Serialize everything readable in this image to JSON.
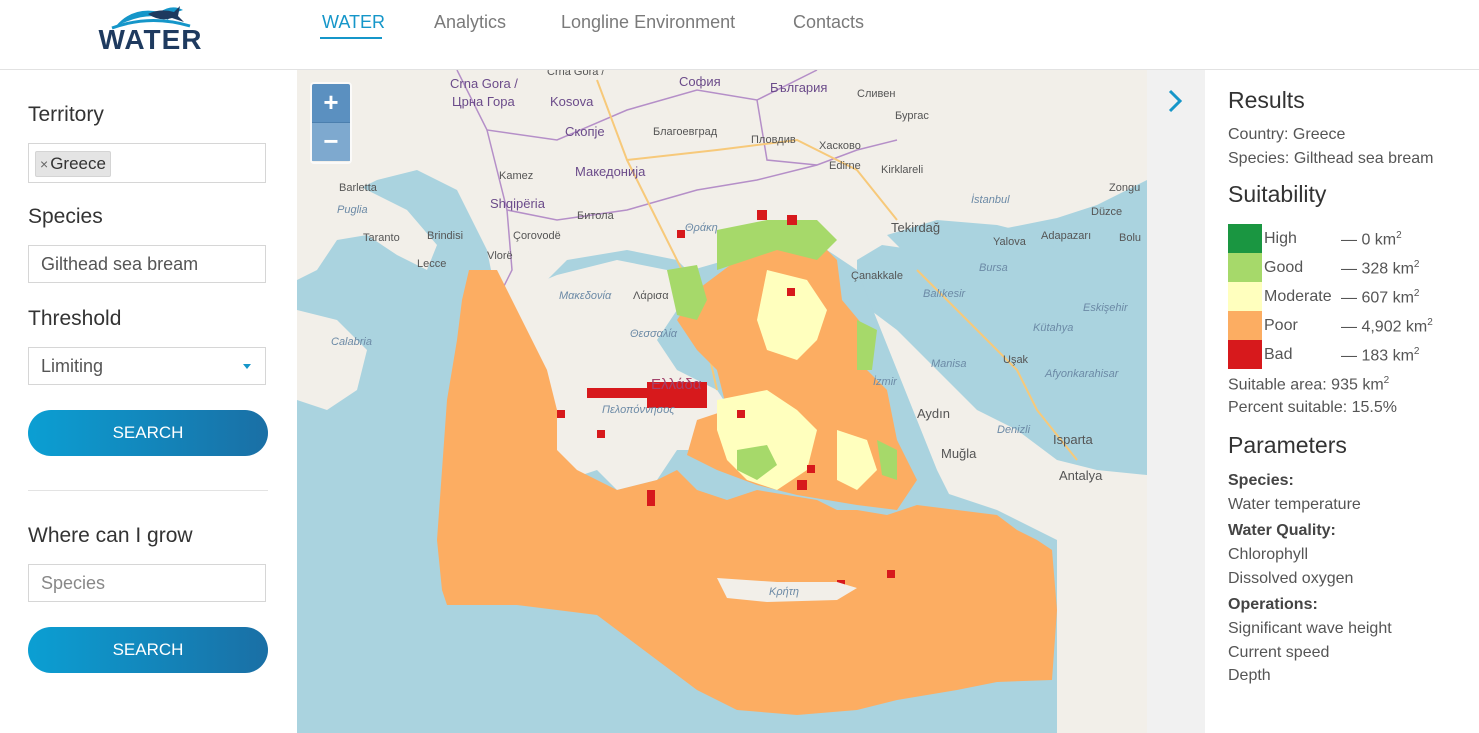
{
  "brand": {
    "name": "WATER"
  },
  "nav": [
    {
      "label": "WATER",
      "active": true
    },
    {
      "label": "Analytics",
      "active": false
    },
    {
      "label": "Longline Environment",
      "active": false
    },
    {
      "label": "Contacts",
      "active": false
    }
  ],
  "left": {
    "territory": {
      "label": "Territory",
      "tag": "Greece",
      "remove_icon": "×"
    },
    "species": {
      "label": "Species",
      "value": "Gilthead sea bream"
    },
    "threshold": {
      "label": "Threshold",
      "value": "Limiting"
    },
    "search_label": "SEARCH",
    "grow": {
      "label": "Where can I grow",
      "placeholder": "Species",
      "search_label": "SEARCH"
    }
  },
  "map": {
    "zoom_in": "+",
    "zoom_out": "−",
    "labels": [
      "Crna Gora /",
      "Црна Гора",
      "Kosova",
      "София",
      "България",
      "Сливен",
      "Бургас",
      "Скопје",
      "Благоевград",
      "Пловдив",
      "Хасково",
      "Edirne",
      "Kirklareli",
      "Македонија",
      "Kamez",
      "Shqipëria",
      "Битола",
      "Θράκη",
      "Tekirdağ",
      "Düzce",
      "Bolu",
      "Yalova",
      "Adapazarı",
      "Barletta",
      "Puglia",
      "Taranto",
      "Brindisi",
      "Lecce",
      "Vlorë",
      "Çorovodë",
      "Μακεδονία",
      "Λάρισα",
      "Θεσσαλία",
      "Ελλάδα",
      "Πελοπόννησος",
      "Calabria",
      "Çanakkale",
      "Balıkesir",
      "Bursa",
      "Kütahya",
      "Eskişehir",
      "Manisa",
      "Uşak",
      "Afyonkarahisar",
      "İzmir",
      "Aydın",
      "Denizli",
      "Isparta",
      "Muğla",
      "Antalya",
      "Κρήτη",
      "İstanbul",
      "Zongu"
    ],
    "colors": {
      "sea": "#aad3df",
      "land": "#f2efe9",
      "poor": "#fcad62",
      "moderate": "#ffffbe",
      "good": "#a6d96a",
      "high": "#1a9641",
      "bad": "#d7191c"
    }
  },
  "collapse": {
    "icon": "chevron-right"
  },
  "results": {
    "title": "Results",
    "country": "Country: Greece",
    "species": "Species: Gilthead sea bream",
    "suitability_title": "Suitability",
    "legend": [
      {
        "label": "High",
        "value": "— 0 km",
        "color": "#1a9641"
      },
      {
        "label": "Good",
        "value": "— 328 km",
        "color": "#a6d96a"
      },
      {
        "label": "Moderate",
        "value": "— 607 km",
        "color": "#ffffbe"
      },
      {
        "label": "Poor",
        "value": "— 4,902 km",
        "color": "#fcad62"
      },
      {
        "label": "Bad",
        "value": "— 183 km",
        "color": "#d7191c"
      }
    ],
    "unit_exp": "2",
    "suitable_area": "Suitable area: 935 km",
    "percent_suitable": "Percent suitable: 15.5%",
    "parameters_title": "Parameters",
    "params": {
      "species_head": "Species:",
      "water_temperature": "Water temperature",
      "water_quality_head": "Water Quality:",
      "chlorophyll": "Chlorophyll",
      "dissolved_oxygen": "Dissolved oxygen",
      "operations_head": "Operations:",
      "wave_height": "Significant wave height",
      "current_speed": "Current speed",
      "depth": "Depth"
    }
  }
}
